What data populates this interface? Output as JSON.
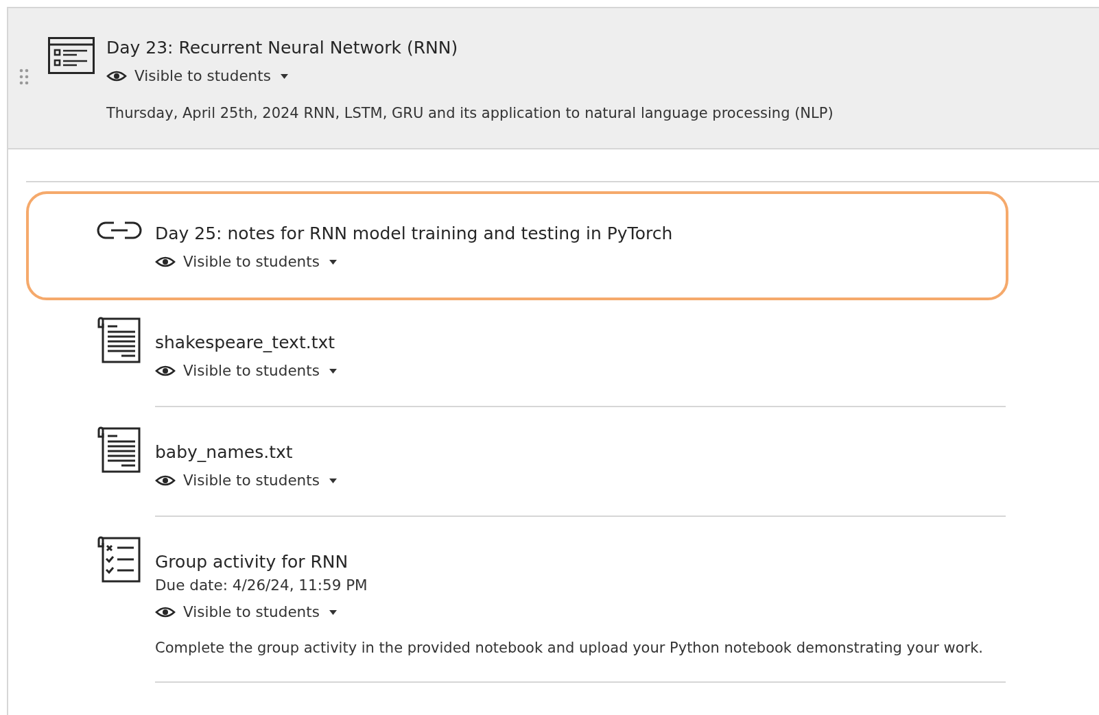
{
  "section": {
    "title": "Day 23: Recurrent Neural Network (RNN)",
    "visibility": "Visible to students",
    "description": "Thursday, April 25th, 2024 RNN, LSTM, GRU and its application to natural language processing (NLP)"
  },
  "items": [
    {
      "kind": "link",
      "title": "Day 25: notes for RNN model training and testing in PyTorch",
      "visibility": "Visible to students",
      "highlighted": true
    },
    {
      "kind": "file",
      "title": "shakespeare_text.txt",
      "visibility": "Visible to students",
      "highlighted": false
    },
    {
      "kind": "file",
      "title": "baby_names.txt",
      "visibility": "Visible to students",
      "highlighted": false
    },
    {
      "kind": "assignment",
      "title": "Group activity for RNN",
      "due_date": "Due date: 4/26/24, 11:59 PM",
      "visibility": "Visible to students",
      "description": "Complete the group activity in the provided notebook and upload your Python notebook demonstrating your work.",
      "highlighted": false
    }
  ]
}
